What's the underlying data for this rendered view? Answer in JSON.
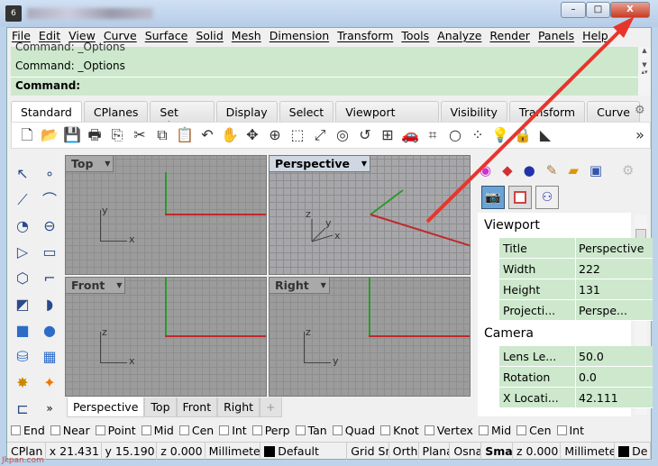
{
  "window": {
    "controls": {
      "minimize": "–",
      "maximize": "□",
      "close": "X"
    },
    "app_icon_text": "6"
  },
  "menu": [
    "File",
    "Edit",
    "View",
    "Curve",
    "Surface",
    "Solid",
    "Mesh",
    "Dimension",
    "Transform",
    "Tools",
    "Analyze",
    "Render",
    "Panels",
    "Help"
  ],
  "command": {
    "history_partial": "Command: _Options",
    "history": "Command: _Options",
    "prompt": "Command:"
  },
  "toolbar_tabs": [
    "Standard",
    "CPlanes",
    "Set View",
    "Display",
    "Select",
    "Viewport Layout",
    "Visibility",
    "Transform",
    "Curve"
  ],
  "toolbar_icons": [
    "new-file",
    "open-folder",
    "save",
    "print",
    "import",
    "cut",
    "copy",
    "paste",
    "undo",
    "pan-hand",
    "rotate-view",
    "zoom-dynamic",
    "zoom-window",
    "zoom-extents",
    "zoom-selected",
    "undo-view",
    "four-viewports",
    "car-render",
    "grid-plane",
    "circle",
    "points",
    "light-bulb",
    "lock",
    "material"
  ],
  "toolbar_more": "»",
  "viewports": [
    {
      "name": "Top",
      "active": false
    },
    {
      "name": "Perspective",
      "active": true
    },
    {
      "name": "Front",
      "active": false
    },
    {
      "name": "Right",
      "active": false
    }
  ],
  "axis_labels": {
    "x": "x",
    "y": "y",
    "z": "z"
  },
  "view_tabs": [
    "Perspective",
    "Top",
    "Front",
    "Right"
  ],
  "view_tab_add": "+",
  "panel": {
    "section_viewport": "Viewport",
    "viewport_props": [
      {
        "key": "Title",
        "value": "Perspective"
      },
      {
        "key": "Width",
        "value": "222"
      },
      {
        "key": "Height",
        "value": "131"
      },
      {
        "key": "Projecti...",
        "value": "Perspe..."
      }
    ],
    "section_camera": "Camera",
    "camera_props": [
      {
        "key": "Lens Le...",
        "value": "50.0"
      },
      {
        "key": "Rotation",
        "value": "0.0"
      },
      {
        "key": "X Locati...",
        "value": "42.111"
      }
    ]
  },
  "osnap": [
    "End",
    "Near",
    "Point",
    "Mid",
    "Cen",
    "Int",
    "Perp",
    "Tan",
    "Quad",
    "Knot",
    "Vertex",
    "Mid",
    "Cen",
    "Int"
  ],
  "status": {
    "cplane": "CPlan",
    "x": "x 21.431",
    "y": "y 15.190",
    "z": "z 0.000",
    "units": "Millimeter",
    "layer": "Default",
    "grid_snap": "Grid Sn",
    "ortho": "Ortho",
    "planar": "Plana",
    "osnap": "Osnap",
    "smart": "Smar",
    "z2": "z 0.000",
    "units2": "Millimeter",
    "layer2": "De"
  },
  "watermark": "Jkpan.com",
  "colors": {
    "command_bg": "#cde8cd",
    "close_button": "#c83a24",
    "annotation_arrow": "#e8352b",
    "x_axis": "#c0282a",
    "y_axis": "#2a9a2a"
  }
}
